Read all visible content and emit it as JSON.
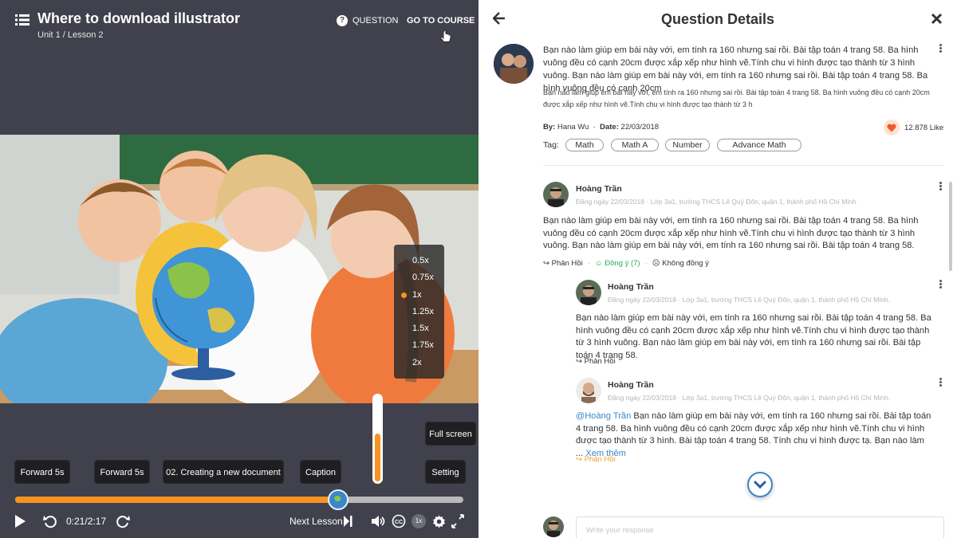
{
  "player": {
    "title": "Where to download illustrator",
    "breadcrumb": "Unit 1 / Lesson 2",
    "question_link": "QUESTION",
    "go_to_course": "GO TO COURSE",
    "speed_options": [
      "0.5x",
      "0.75x",
      "1x",
      "1.25x",
      "1.5x",
      "1.75x",
      "2x"
    ],
    "speed_selected": "1x",
    "volume_level": 0.58,
    "buttons": {
      "forward_1": "Forward 5s",
      "forward_2": "Forward 5s",
      "chapter": "02. Creating a new document",
      "caption": "Caption",
      "setting": "Setting",
      "fullscreen": "Full screen"
    },
    "progress_fraction": 0.72,
    "time": "0:21/2:17",
    "next_lesson": "Next Lesson",
    "speed_badge": "1x",
    "colors": {
      "accent": "#f7931e",
      "thumb": "#3b87c8",
      "bg": "#40414c"
    },
    "icons": [
      "menu-icon",
      "question-icon",
      "cursor-icon",
      "play-icon",
      "replay-icon",
      "forward-icon",
      "skip-next-icon",
      "volume-icon",
      "cc-icon",
      "gear-icon",
      "fullscreen-icon"
    ]
  },
  "details": {
    "title": "Question Details",
    "question": {
      "body": "Bạn nào làm giúp em bài này với, em tính ra 160 nhưng sai rồi. Bài tập toán 4 trang 58. Ba hình vuông đều có cạnh 20cm được xắp xếp như hình vẽ.Tính chu vi hình được tạo thành từ 3 hình vuông. Bạn nào làm giúp em bài này với, em tính ra 160 nhưng sai rồi. Bài tập toán 4 trang 58. Ba hình vuông đều có cạnh 20cm",
      "body_small": "Bạn nào làm giúp em bài này với, em tính ra 160 nhưng sai rồi. Bài tập toán 4 trang 58. Ba hình vuông đều có cạnh 20cm được xắp xếp như hình vẽ.Tính chu vi hình được tạo thành từ 3 h",
      "by_label": "By:",
      "author": "Hana Wu",
      "date_label": "Date:",
      "date": "22/03/2018",
      "likes": "12.878 Like",
      "tag_label": "Tag:",
      "tags": [
        "Math",
        "Math A",
        "Number",
        "Advance Math"
      ]
    },
    "comments": [
      {
        "name": "Hoàng Trần",
        "sub": "Đăng ngày 22/03/2018  ·  Lớp 3a1, trường THCS Lê Quý Đôn, quận 1, thành phố Hồ Chí Minh",
        "body": "Bạn nào làm giúp em bài này với, em tính ra 160 nhưng sai rồi. Bài tập toán 4 trang 58. Ba hình vuông đều có cạnh 20cm được xắp xếp như hình vẽ.Tính chu vi hình được tạo thành từ 3 hình vuông. Bạn nào làm giúp em bài này với, em tính ra 160 nhưng sai rồi. Bài tập toán 4 trang 58.",
        "reply": "Phản Hồi",
        "agree": "Đồng ý (7)",
        "disagree": "Không đồng ý"
      },
      {
        "name": "Hoàng Trần",
        "sub": "Đăng ngày 22/03/2018  ·  Lớp 3a1, trường THCS Lê Quý Đôn, quận 1, thành phố Hồ Chí Minh.",
        "body": "Bạn nào làm giúp em bài này với, em tính ra 160 nhưng sai rồi. Bài tập toán 4 trang 58. Ba hình vuông đều có cạnh 20cm được xắp xếp như hình vẽ.Tính chu vi hình được tạo thành từ 3 hình vuông. Bạn nào làm giúp em bài này với, em tính ra 160 nhưng sai rồi. Bài tập toán 4 trang 58.",
        "reply": "Phản Hồi"
      },
      {
        "name": "Hoàng Trần",
        "sub": "Đăng ngày 22/03/2018  ·  Lớp 3a1, trường THCS Lê Quý Đôn, quận 1, thành phố Hồ Chí Minh.",
        "mention": "@Hoàng Trần",
        "body": " Bạn nào làm giúp em bài này với, em tính ra 160 nhưng sai rồi. Bài tập toán 4 trang 58. Ba hình vuông đều có cạnh 20cm được xắp xếp như hình vẽ.Tính chu vi hình được tạo thành từ 3 hình. Bài tập toán 4 trang 58. Tính chu vi hình được tạ. Bạn nào làm ... ",
        "see_more": "Xem thêm",
        "reply": "Phản Hồi"
      }
    ],
    "response_placeholder": "Write your response"
  }
}
